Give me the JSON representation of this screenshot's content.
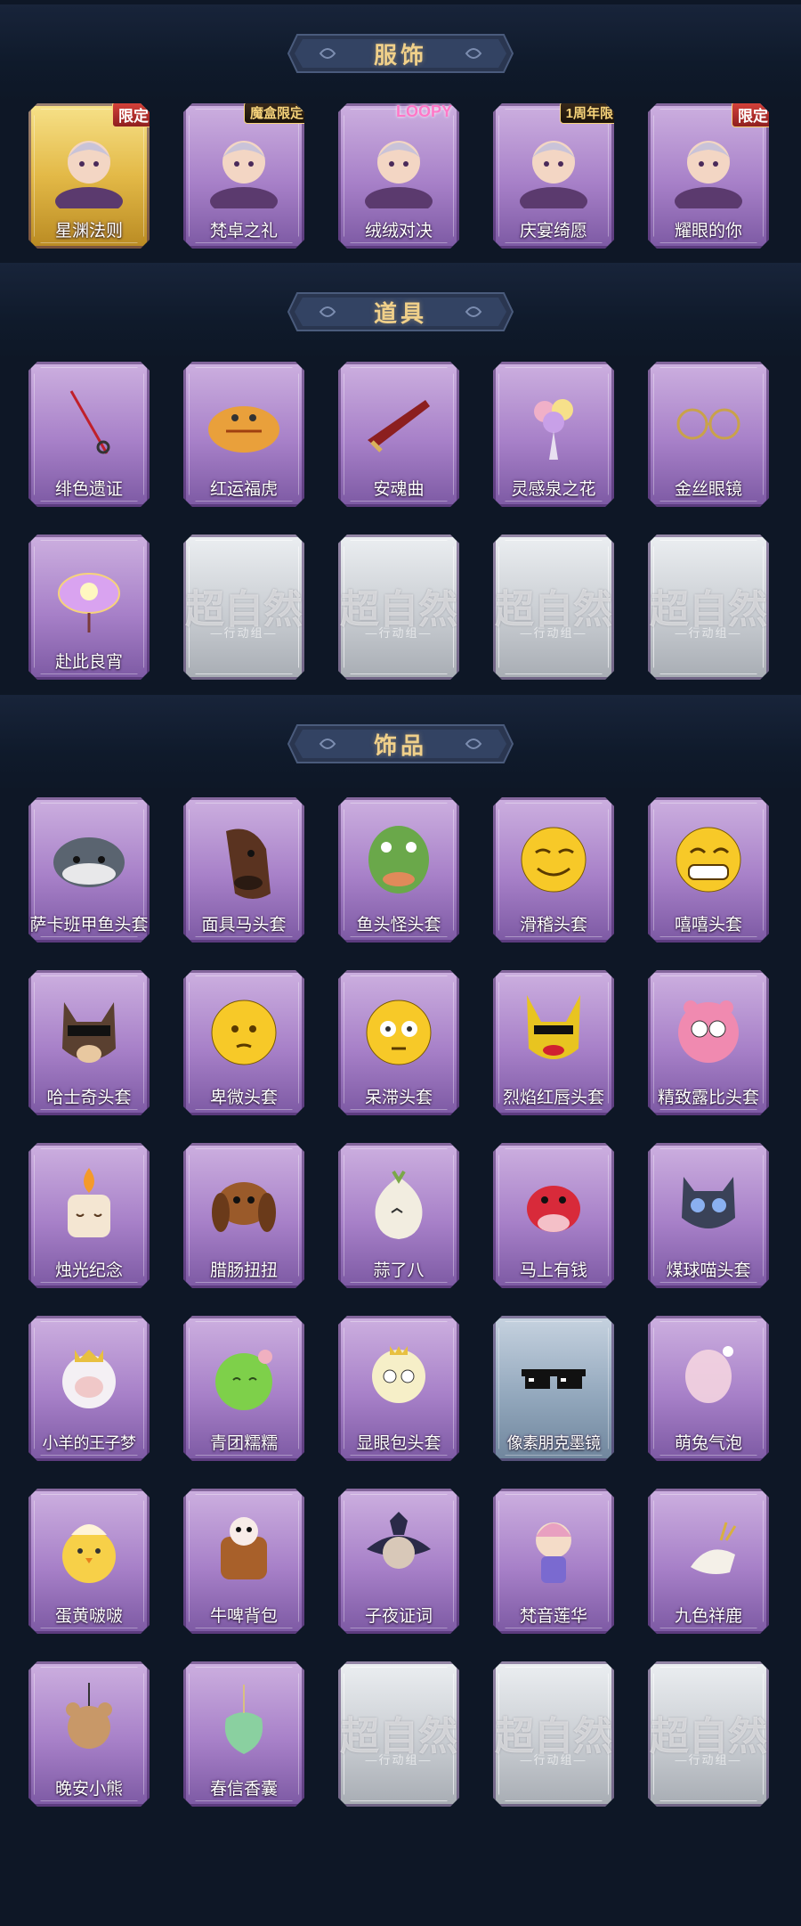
{
  "sections": [
    {
      "title": "服饰",
      "items": [
        {
          "label": "星渊法则",
          "badge": "限定",
          "style": "gold",
          "icon": "costume-portrait-icon"
        },
        {
          "label": "梵卓之礼",
          "badge": "魔盒限定",
          "style": "purple",
          "icon": "costume-portrait-icon"
        },
        {
          "label": "绒绒对决",
          "badge": "LOOPY",
          "style": "purple",
          "icon": "costume-portrait-icon"
        },
        {
          "label": "庆宴绮愿",
          "badge": "1周年限",
          "style": "purple",
          "icon": "costume-portrait-icon"
        },
        {
          "label": "耀眼的你",
          "badge": "限定",
          "style": "purple",
          "icon": "costume-portrait-icon"
        }
      ]
    },
    {
      "title": "道具",
      "items": [
        {
          "label": "绯色遗证",
          "icon": "rapier-icon"
        },
        {
          "label": "红运福虎",
          "icon": "tiger-plush-icon"
        },
        {
          "label": "安魂曲",
          "icon": "blade-icon"
        },
        {
          "label": "灵感泉之花",
          "icon": "bouquet-icon"
        },
        {
          "label": "金丝眼镜",
          "icon": "glasses-icon"
        },
        {
          "label": "赴此良宵",
          "icon": "lantern-icon"
        },
        {
          "empty": true
        },
        {
          "empty": true
        },
        {
          "empty": true
        },
        {
          "empty": true
        }
      ]
    },
    {
      "title": "饰品",
      "items": [
        {
          "label": "萨卡班甲鱼头套",
          "icon": "fish-mask-icon"
        },
        {
          "label": "面具马头套",
          "icon": "horse-mask-icon"
        },
        {
          "label": "鱼头怪头套",
          "icon": "fishhead-mask-icon"
        },
        {
          "label": "滑稽头套",
          "icon": "smirk-emoji-icon"
        },
        {
          "label": "嘻嘻头套",
          "icon": "grin-emoji-icon"
        },
        {
          "label": "哈士奇头套",
          "icon": "husky-mask-icon"
        },
        {
          "label": "卑微头套",
          "icon": "humble-emoji-icon"
        },
        {
          "label": "呆滞头套",
          "icon": "dazed-emoji-icon"
        },
        {
          "label": "烈焰红唇头套",
          "icon": "pikachu-mask-icon"
        },
        {
          "label": "精致露比头套",
          "icon": "ruby-mask-icon"
        },
        {
          "label": "烛光纪念",
          "icon": "candle-icon"
        },
        {
          "label": "腊肠扭扭",
          "icon": "dachshund-icon"
        },
        {
          "label": "蒜了八",
          "icon": "garlic-icon"
        },
        {
          "label": "马上有钱",
          "icon": "red-horse-icon"
        },
        {
          "label": "煤球喵头套",
          "icon": "cat-mask-icon"
        },
        {
          "label": "小羊的王子梦",
          "icon": "sheep-crown-icon",
          "small": true
        },
        {
          "label": "青团糯糯",
          "icon": "green-dumpling-icon"
        },
        {
          "label": "显眼包头套",
          "icon": "bulb-head-icon"
        },
        {
          "label": "像素朋克墨镜",
          "icon": "pixel-sunglasses-icon",
          "style": "blue",
          "small": true
        },
        {
          "label": "萌兔气泡",
          "icon": "bunny-bubble-icon"
        },
        {
          "label": "蛋黄啵啵",
          "icon": "chick-icon"
        },
        {
          "label": "牛啤背包",
          "icon": "cow-backpack-icon"
        },
        {
          "label": "子夜证词",
          "icon": "owl-figure-icon"
        },
        {
          "label": "梵音莲华",
          "icon": "chibi-figure-icon"
        },
        {
          "label": "九色祥鹿",
          "icon": "deer-icon"
        },
        {
          "label": "晚安小熊",
          "icon": "bear-charm-icon"
        },
        {
          "label": "春信香囊",
          "icon": "sachet-icon"
        },
        {
          "empty": true
        },
        {
          "empty": true
        },
        {
          "empty": true
        }
      ]
    }
  ],
  "placeholder": {
    "watermark": "超自然",
    "subtitle": "—行动组—"
  }
}
